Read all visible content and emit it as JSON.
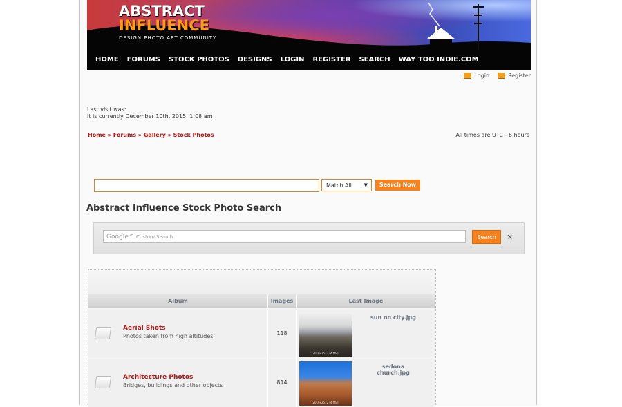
{
  "header": {
    "logo_line1": "ABSTRACT",
    "logo_line2": "INFLUENCE",
    "logo_tagline": "DESIGN  PHOTO  ART  COMMUNITY",
    "nav": [
      "HOME",
      "FORUMS",
      "STOCK PHOTOS",
      "DESIGNS",
      "LOGIN",
      "REGISTER",
      "SEARCH",
      "WAY TOO INDIE.COM"
    ]
  },
  "user_links": {
    "login": "Login",
    "register": "Register"
  },
  "visit": {
    "last_visit": "Last visit was:",
    "current": "It is currently December 10th, 2015, 1:08 am"
  },
  "breadcrumb": [
    "Home",
    "Forums",
    "Gallery",
    "Stock Photos"
  ],
  "breadcrumb_sep": " » ",
  "timezone": "All times are UTC - 6 hours",
  "search": {
    "query": "",
    "match_option": "Match All",
    "button": "Search Now"
  },
  "section_title": "Abstract Influence Stock Photo Search",
  "google_search": {
    "brand": "Google™",
    "placeholder": "Custom Search",
    "button": "Search",
    "clear": "×"
  },
  "table": {
    "headers": {
      "album": "Album",
      "images": "Images",
      "last_image": "Last Image"
    },
    "rows": [
      {
        "name": "Aerial Shots",
        "desc": "Photos taken from high altitudes",
        "count": "118",
        "last_image": "sun on city.jpg",
        "thumb_caption": "2016x2512 (4 MB)"
      },
      {
        "name": "Architecture Photos",
        "desc": "Bridges, buildings and other objects",
        "count": "814",
        "last_image": "sedona church.jpg",
        "thumb_caption": "2016x2512 (4 MB)"
      }
    ]
  },
  "colors": {
    "accent_orange": "#f5821f",
    "link_red": "#b01818",
    "banner_bg": "#050505"
  }
}
